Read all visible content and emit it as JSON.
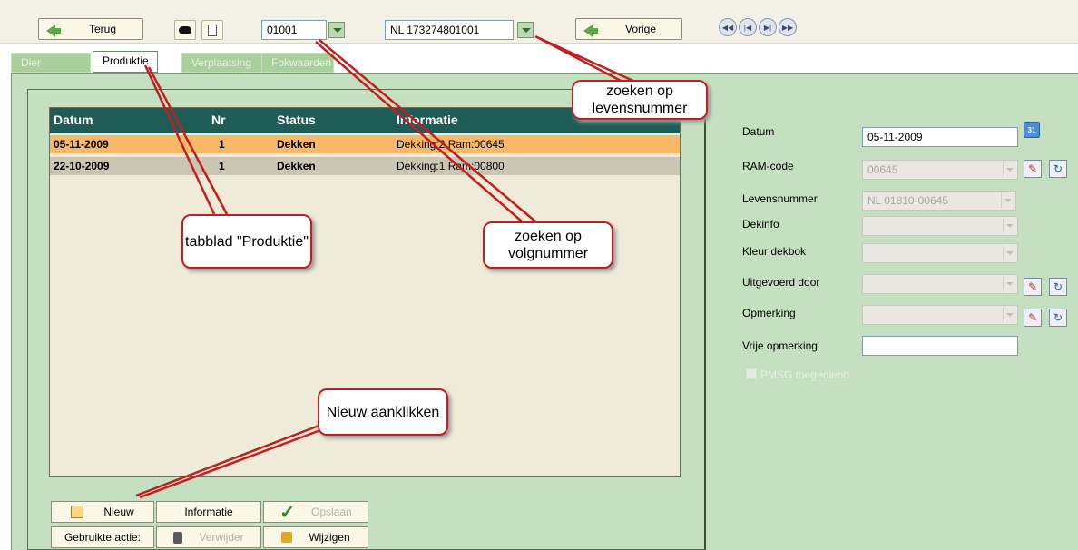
{
  "toolbar": {
    "back_label": "Terug",
    "volgnummer_value": "01001",
    "levensnummer_value": "NL 173274801001",
    "prev_label": "Vorige"
  },
  "tabs": [
    "Dier",
    "Produktie",
    "Verplaatsing",
    "Fokwaarden"
  ],
  "grid": {
    "columns": [
      "Datum",
      "Nr",
      "Status",
      "Informatie"
    ],
    "rows": [
      {
        "datum": "05-11-2009",
        "nr": "1",
        "status": "Dekken",
        "info": "Dekking:2 Ram:00645"
      },
      {
        "datum": "22-10-2009",
        "nr": "1",
        "status": "Dekken",
        "info": "Dekking:1 Ram:00800"
      }
    ]
  },
  "form": {
    "datum_label": "Datum",
    "datum_value": "05-11-2009",
    "ram_label": "RAM-code",
    "ram_value": "00645",
    "levensnummer_label": "Levensnummer",
    "levensnummer_value": "NL 01810-00645",
    "dekinfo_label": "Dekinfo",
    "kleur_label": "Kleur dekbok",
    "uitgevoerd_label": "Uitgevoerd door",
    "opmerking_label": "Opmerking",
    "vrije_label": "Vrije opmerking",
    "pmsg_label": "PMSG toegediend"
  },
  "buttons": {
    "nieuw": "Nieuw",
    "informatie": "Informatie",
    "opslaan": "Opslaan",
    "gebruikte": "Gebruikte actie:",
    "verwijder": "Verwijder",
    "wijzigen": "Wijzigen"
  },
  "callouts": {
    "levensnummer": "zoeken op levensnummer",
    "tabblad": "tabblad \"Produktie\"",
    "volgnummer": "zoeken op volgnummer",
    "nieuw": "Nieuw aanklikken"
  },
  "colors": {
    "panel": "#c5e0c0",
    "header": "#1e5d57",
    "row_selected": "#f7b867",
    "row_other": "#cbc6b4",
    "callout_border": "#c02020"
  }
}
